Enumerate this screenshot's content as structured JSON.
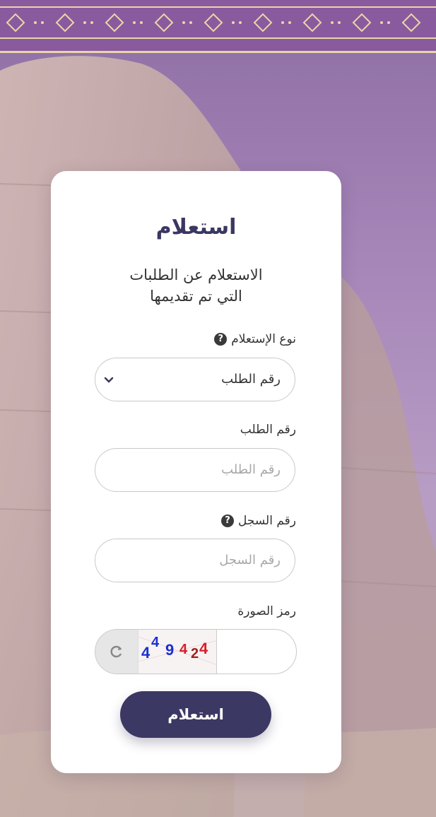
{
  "card": {
    "title": "استعلام",
    "subtitle_line1": "الاستعلام عن الطلبات",
    "subtitle_line2": "التي تم تقديمها"
  },
  "inquiry_type": {
    "label": "نوع الإستعلام",
    "selected": "رقم الطلب"
  },
  "request_number": {
    "label": "رقم الطلب",
    "placeholder": "رقم الطلب"
  },
  "registry_number": {
    "label": "رقم السجل",
    "placeholder": "رقم السجل"
  },
  "captcha": {
    "label": "رمز الصورة",
    "code_chars": [
      "4",
      "4",
      "9",
      "4",
      "2",
      "4"
    ]
  },
  "submit_label": "استعلام",
  "colors": {
    "primary": "#3b3863",
    "card_bg": "#ffffff",
    "background": "#a584b8"
  }
}
